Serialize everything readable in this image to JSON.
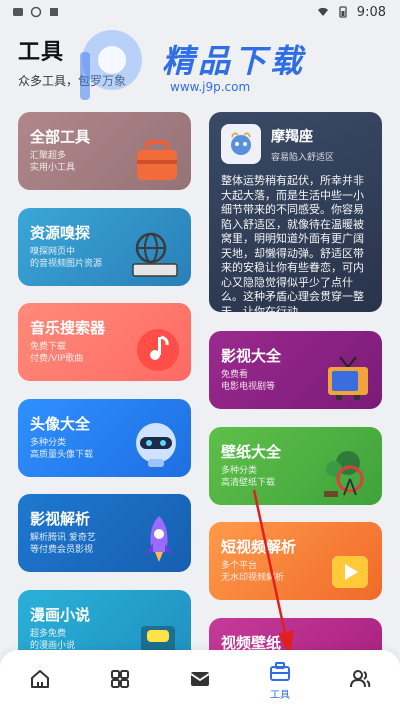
{
  "status_bar": {
    "time": "9:08"
  },
  "header": {
    "title": "工具",
    "subtitle": "众多工具，包罗万象"
  },
  "watermark": {
    "brand": "精品下载",
    "url": "www.j9p.com"
  },
  "left_cards": [
    {
      "title": "全部工具",
      "desc_lines": [
        "汇聚超多",
        "实用小工具"
      ]
    },
    {
      "title": "资源嗅探",
      "desc_lines": [
        "嗅探网页中",
        "的音视频图片资源"
      ]
    },
    {
      "title": "音乐搜索器",
      "desc_lines": [
        "免费下载",
        "付费/VIP歌曲"
      ]
    },
    {
      "title": "头像大全",
      "desc_lines": [
        "多种分类",
        "高质量头像下载"
      ]
    },
    {
      "title": "影视解析",
      "desc_lines": [
        "解析腾讯 爱奇艺",
        "等付费会员影视"
      ]
    },
    {
      "title": "漫画小说",
      "desc_lines": [
        "超多免费",
        "的漫画小说"
      ]
    }
  ],
  "zodiac_card": {
    "name": "摩羯座",
    "subtitle": "容易陷入舒适区",
    "body": "整体运势稍有起伏，所幸并非大起大落，而是生活中些一小细节带来的不同感受。你容易陷入舒适区，就像待在温暖被窝里，明明知道外面有更广阔天地，却懒得动弹。舒适区带来的安稳让你有些眷恋，可内心又隐隐觉得似乎少了点什么。这种矛盾心理会贯穿一整天，让你在行动..."
  },
  "right_cards": [
    {
      "title": "影视大全",
      "desc_lines": [
        "免费看",
        "电影电视剧等"
      ]
    },
    {
      "title": "壁纸大全",
      "desc_lines": [
        "多种分类",
        "高清壁纸下载"
      ]
    },
    {
      "title": "短视频解析",
      "desc_lines": [
        "多个平台",
        "无水印视频解析"
      ]
    },
    {
      "title": "视频壁纸",
      "desc_lines": [
        ""
      ]
    }
  ],
  "bottom_nav": [
    {
      "label": "",
      "icon": "home-icon"
    },
    {
      "label": "",
      "icon": "grid-icon"
    },
    {
      "label": "",
      "icon": "mail-icon"
    },
    {
      "label": "工具",
      "icon": "toolbox-icon",
      "active": true
    },
    {
      "label": "",
      "icon": "users-icon"
    }
  ],
  "colors": {
    "accent": "#2f6ee6",
    "arrow": "#e02020"
  }
}
